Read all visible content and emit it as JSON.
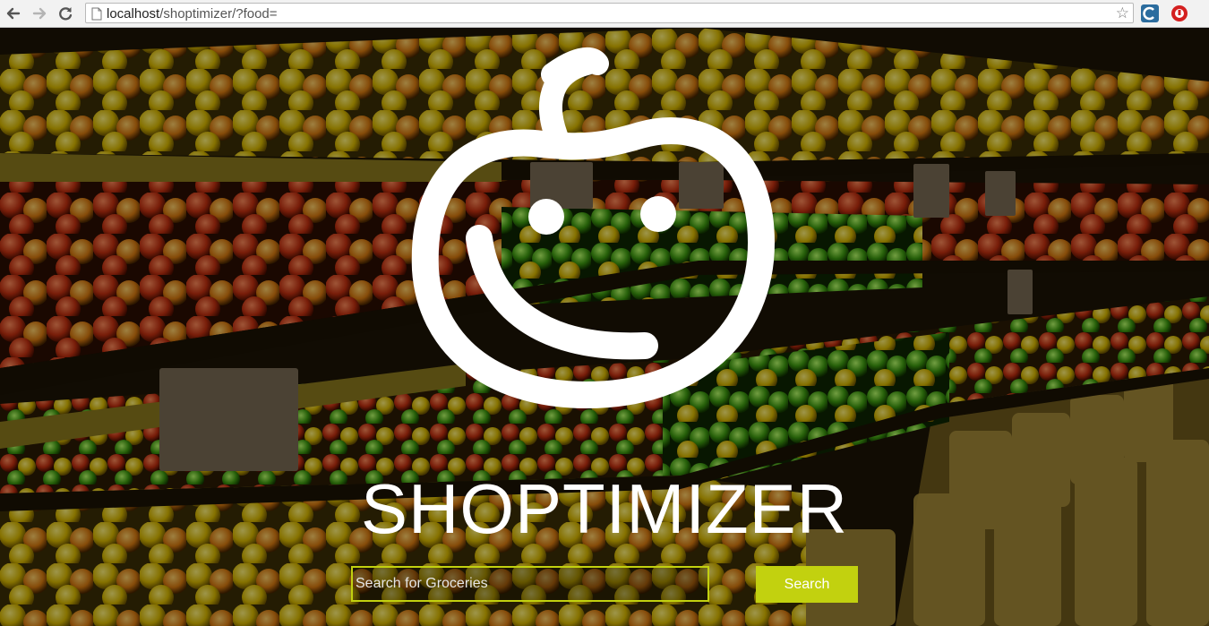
{
  "browser": {
    "url_host": "localhost",
    "url_path": "/shoptimizer/?food=",
    "back_icon": "back-arrow-icon",
    "forward_icon": "forward-arrow-icon",
    "reload_icon": "reload-icon",
    "bookmark_icon": "star-icon",
    "extensions": [
      "extension-icon-c",
      "extension-icon-red"
    ]
  },
  "hero": {
    "logo_icon": "smiling-apple-logo-icon",
    "brand_title": "SHOPTIMIZER",
    "search_placeholder": "Search for Groceries",
    "search_value": "",
    "search_button_label": "Search",
    "accent_color": "#c2d10f"
  }
}
